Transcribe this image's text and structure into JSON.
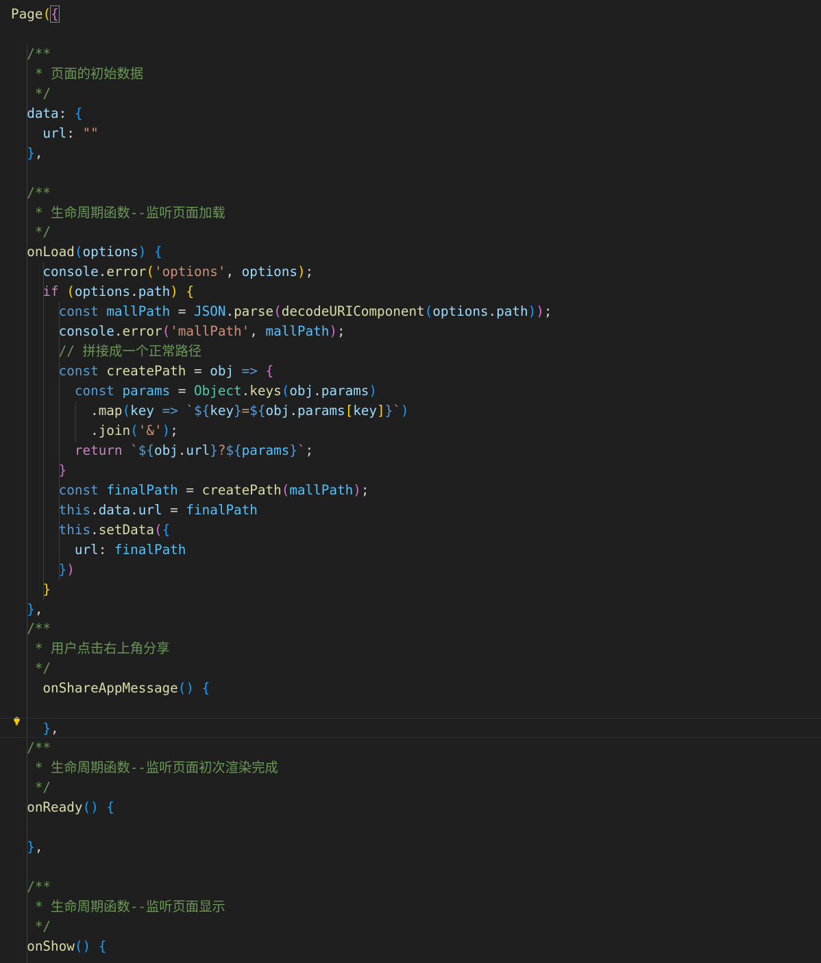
{
  "editor": {
    "lines": [
      [
        [
          "fn",
          "Page"
        ],
        [
          "b1",
          "("
        ],
        [
          "b2",
          "{"
        ]
      ],
      [],
      [
        [
          "cm",
          "  /**"
        ]
      ],
      [
        [
          "cm",
          "   * 页面的初始数据"
        ]
      ],
      [
        [
          "cm",
          "   */"
        ]
      ],
      [
        [
          "var",
          "  data"
        ],
        [
          "p",
          ": "
        ],
        [
          "b3",
          "{"
        ]
      ],
      [
        [
          "var",
          "    url"
        ],
        [
          "p",
          ": "
        ],
        [
          "str",
          "\"\""
        ]
      ],
      [
        [
          "b3",
          "  }"
        ],
        [
          "p",
          ","
        ]
      ],
      [],
      [
        [
          "cm",
          "  /**"
        ]
      ],
      [
        [
          "cm",
          "   * 生命周期函数--监听页面加载"
        ]
      ],
      [
        [
          "cm",
          "   */"
        ]
      ],
      [
        [
          "fn",
          "  onLoad"
        ],
        [
          "b3",
          "("
        ],
        [
          "var",
          "options"
        ],
        [
          "b3",
          ")"
        ],
        [
          "p",
          " "
        ],
        [
          "b3",
          "{"
        ]
      ],
      [
        [
          "var",
          "    console"
        ],
        [
          "p",
          "."
        ],
        [
          "fn",
          "error"
        ],
        [
          "b1",
          "("
        ],
        [
          "str",
          "'options'"
        ],
        [
          "p",
          ", "
        ],
        [
          "var",
          "options"
        ],
        [
          "b1",
          ")"
        ],
        [
          "p",
          ";"
        ]
      ],
      [
        [
          "ctl",
          "    if"
        ],
        [
          "p",
          " "
        ],
        [
          "b1",
          "("
        ],
        [
          "var",
          "options"
        ],
        [
          "p",
          "."
        ],
        [
          "var",
          "path"
        ],
        [
          "b1",
          ")"
        ],
        [
          "p",
          " "
        ],
        [
          "b1",
          "{"
        ]
      ],
      [
        [
          "kw",
          "      const"
        ],
        [
          "p",
          " "
        ],
        [
          "cst",
          "mallPath"
        ],
        [
          "p",
          " = "
        ],
        [
          "cst",
          "JSON"
        ],
        [
          "p",
          "."
        ],
        [
          "fn",
          "parse"
        ],
        [
          "b2",
          "("
        ],
        [
          "fn",
          "decodeURIComponent"
        ],
        [
          "b3",
          "("
        ],
        [
          "var",
          "options"
        ],
        [
          "p",
          "."
        ],
        [
          "var",
          "path"
        ],
        [
          "b3",
          ")"
        ],
        [
          "b2",
          ")"
        ],
        [
          "p",
          ";"
        ]
      ],
      [
        [
          "var",
          "      console"
        ],
        [
          "p",
          "."
        ],
        [
          "fn",
          "error"
        ],
        [
          "b2",
          "("
        ],
        [
          "str",
          "'mallPath'"
        ],
        [
          "p",
          ", "
        ],
        [
          "cst",
          "mallPath"
        ],
        [
          "b2",
          ")"
        ],
        [
          "p",
          ";"
        ]
      ],
      [
        [
          "cm",
          "      // 拼接成一个正常路径"
        ]
      ],
      [
        [
          "kw",
          "      const"
        ],
        [
          "p",
          " "
        ],
        [
          "fn",
          "createPath"
        ],
        [
          "p",
          " = "
        ],
        [
          "var",
          "obj"
        ],
        [
          "p",
          " "
        ],
        [
          "kw",
          "=>"
        ],
        [
          "p",
          " "
        ],
        [
          "b2",
          "{"
        ]
      ],
      [
        [
          "kw",
          "        const"
        ],
        [
          "p",
          " "
        ],
        [
          "cst",
          "params"
        ],
        [
          "p",
          " = "
        ],
        [
          "cls",
          "Object"
        ],
        [
          "p",
          "."
        ],
        [
          "fn",
          "keys"
        ],
        [
          "b3",
          "("
        ],
        [
          "var",
          "obj"
        ],
        [
          "p",
          "."
        ],
        [
          "var",
          "params"
        ],
        [
          "b3",
          ")"
        ]
      ],
      [
        [
          "p",
          "          ."
        ],
        [
          "fn",
          "map"
        ],
        [
          "b3",
          "("
        ],
        [
          "var",
          "key"
        ],
        [
          "p",
          " "
        ],
        [
          "kw",
          "=>"
        ],
        [
          "p",
          " "
        ],
        [
          "str",
          "`"
        ],
        [
          "kw",
          "${"
        ],
        [
          "var",
          "key"
        ],
        [
          "kw",
          "}"
        ],
        [
          "str",
          "="
        ],
        [
          "kw",
          "${"
        ],
        [
          "var",
          "obj"
        ],
        [
          "p",
          "."
        ],
        [
          "var",
          "params"
        ],
        [
          "b1",
          "["
        ],
        [
          "var",
          "key"
        ],
        [
          "b1",
          "]"
        ],
        [
          "kw",
          "}"
        ],
        [
          "str",
          "`"
        ],
        [
          "b3",
          ")"
        ]
      ],
      [
        [
          "p",
          "          ."
        ],
        [
          "fn",
          "join"
        ],
        [
          "b3",
          "("
        ],
        [
          "str",
          "'&'"
        ],
        [
          "b3",
          ")"
        ],
        [
          "p",
          ";"
        ]
      ],
      [
        [
          "ctl",
          "        return"
        ],
        [
          "p",
          " "
        ],
        [
          "str",
          "`"
        ],
        [
          "kw",
          "${"
        ],
        [
          "var",
          "obj"
        ],
        [
          "p",
          "."
        ],
        [
          "var",
          "url"
        ],
        [
          "kw",
          "}"
        ],
        [
          "str",
          "?"
        ],
        [
          "kw",
          "${"
        ],
        [
          "cst",
          "params"
        ],
        [
          "kw",
          "}"
        ],
        [
          "str",
          "`"
        ],
        [
          "p",
          ";"
        ]
      ],
      [
        [
          "b2",
          "      }"
        ]
      ],
      [
        [
          "kw",
          "      const"
        ],
        [
          "p",
          " "
        ],
        [
          "cst",
          "finalPath"
        ],
        [
          "p",
          " = "
        ],
        [
          "fn",
          "createPath"
        ],
        [
          "b2",
          "("
        ],
        [
          "cst",
          "mallPath"
        ],
        [
          "b2",
          ")"
        ],
        [
          "p",
          ";"
        ]
      ],
      [
        [
          "kw",
          "      this"
        ],
        [
          "p",
          "."
        ],
        [
          "var",
          "data"
        ],
        [
          "p",
          "."
        ],
        [
          "var",
          "url"
        ],
        [
          "p",
          " = "
        ],
        [
          "cst",
          "finalPath"
        ]
      ],
      [
        [
          "kw",
          "      this"
        ],
        [
          "p",
          "."
        ],
        [
          "fn",
          "setData"
        ],
        [
          "b2",
          "("
        ],
        [
          "b3",
          "{"
        ]
      ],
      [
        [
          "var",
          "        url"
        ],
        [
          "p",
          ": "
        ],
        [
          "cst",
          "finalPath"
        ]
      ],
      [
        [
          "b3",
          "      }"
        ],
        [
          "b2",
          ")"
        ]
      ],
      [
        [
          "b1",
          "    }"
        ]
      ],
      [
        [
          "b3",
          "  }"
        ],
        [
          "p",
          ","
        ]
      ],
      [
        [
          "cm",
          "  /**"
        ]
      ],
      [
        [
          "cm",
          "   * 用户点击右上角分享"
        ]
      ],
      [
        [
          "cm",
          "   */"
        ]
      ],
      [
        [
          "fn",
          "    onShareAppMessage"
        ],
        [
          "b3",
          "("
        ],
        [
          "b3",
          ")"
        ],
        [
          "p",
          " "
        ],
        [
          "b3",
          "{"
        ]
      ],
      [],
      [
        [
          "b3",
          "    }"
        ],
        [
          "p",
          ","
        ]
      ],
      [
        [
          "cm",
          "  /**"
        ]
      ],
      [
        [
          "cm",
          "   * 生命周期函数--监听页面初次渲染完成"
        ]
      ],
      [
        [
          "cm",
          "   */"
        ]
      ],
      [
        [
          "fn",
          "  onReady"
        ],
        [
          "b3",
          "("
        ],
        [
          "b3",
          ")"
        ],
        [
          "p",
          " "
        ],
        [
          "b3",
          "{"
        ]
      ],
      [],
      [
        [
          "b3",
          "  }"
        ],
        [
          "p",
          ","
        ]
      ],
      [],
      [
        [
          "cm",
          "  /**"
        ]
      ],
      [
        [
          "cm",
          "   * 生命周期函数--监听页面显示"
        ]
      ],
      [
        [
          "cm",
          "   */"
        ]
      ],
      [
        [
          "fn",
          "  onShow"
        ],
        [
          "b3",
          "("
        ],
        [
          "b3",
          ")"
        ],
        [
          "p",
          " "
        ],
        [
          "b3",
          "{"
        ]
      ]
    ],
    "current_line_index": 36,
    "lightbulb_icon": "lightbulb-icon"
  },
  "colors": {
    "background": "#1f1f1f",
    "comment": "#6a9955",
    "string": "#ce9178",
    "function": "#dcdcaa",
    "variable": "#9cdcfe",
    "keyword": "#569cd6",
    "lightbulb": "#ffcc00"
  }
}
